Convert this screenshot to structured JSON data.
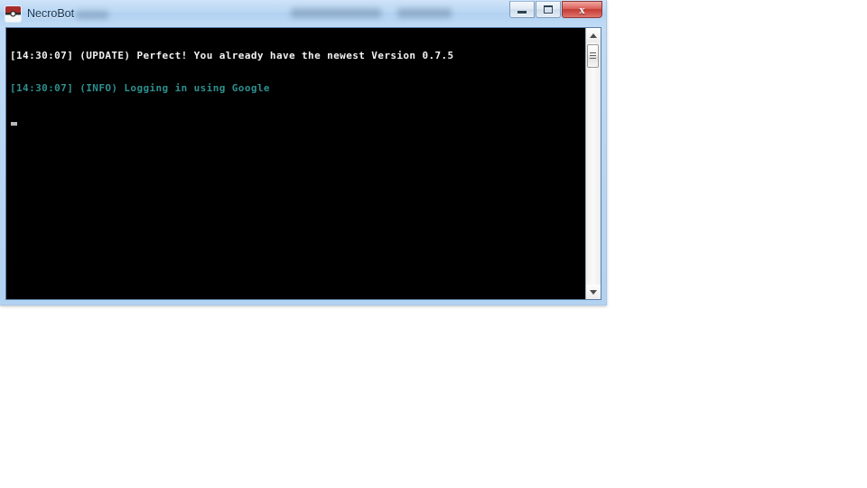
{
  "window": {
    "title": "NecroBot",
    "icon_name": "pokeball-icon",
    "redacted_segments": 3,
    "controls": {
      "minimize_label": "Minimize",
      "maximize_label": "Maximize",
      "close_label": "x"
    }
  },
  "console": {
    "background_color": "#000000",
    "caret": "_",
    "lines": [
      {
        "text": "[14:30:07] (UPDATE) Perfect! You already have the newest Version 0.7.5",
        "color": "#f2f2f2",
        "timestamp": "14:30:07",
        "level": "UPDATE",
        "message": "Perfect! You already have the newest Version 0.7.5",
        "version": "0.7.5"
      },
      {
        "text": "[14:30:07] (INFO) Logging in using Google",
        "color": "#2e8f8f",
        "timestamp": "14:30:07",
        "level": "INFO",
        "message": "Logging in using Google"
      }
    ]
  },
  "scrollbar": {
    "up_arrow": "▲",
    "down_arrow": "▼",
    "thumb_position": "top"
  }
}
